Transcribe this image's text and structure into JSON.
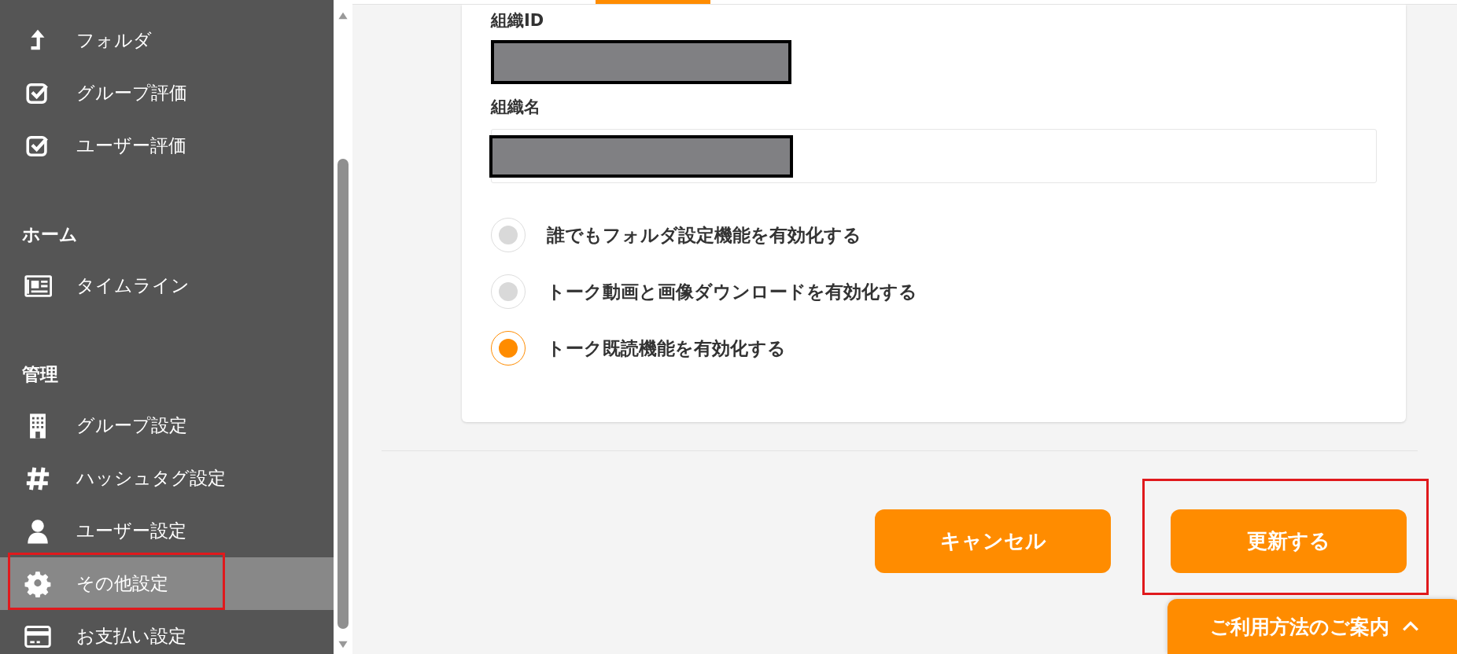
{
  "sidebar": {
    "sections": [
      {
        "items": [
          {
            "label": "フォルダ",
            "kind": "folder-up",
            "selected": false,
            "highlighted": false
          },
          {
            "label": "グループ評価",
            "kind": "check",
            "selected": false,
            "highlighted": false
          },
          {
            "label": "ユーザー評価",
            "kind": "check",
            "selected": false,
            "highlighted": false
          }
        ]
      },
      {
        "heading": "ホーム",
        "items": [
          {
            "label": "タイムライン",
            "kind": "news",
            "selected": false,
            "highlighted": false
          }
        ]
      },
      {
        "heading": "管理",
        "items": [
          {
            "label": "グループ設定",
            "kind": "building",
            "selected": false,
            "highlighted": false
          },
          {
            "label": "ハッシュタグ設定",
            "kind": "hash",
            "selected": false,
            "highlighted": false
          },
          {
            "label": "ユーザー設定",
            "kind": "user",
            "selected": false,
            "highlighted": false
          },
          {
            "label": "その他設定",
            "kind": "gear",
            "selected": true,
            "highlighted": true
          },
          {
            "label": "お支払い設定",
            "kind": "card",
            "selected": false,
            "highlighted": false
          }
        ]
      }
    ]
  },
  "form": {
    "fields": [
      {
        "label": "組織ID",
        "kind": "plain",
        "redacted": true
      },
      {
        "label": "組織名",
        "kind": "input",
        "redacted": true
      }
    ],
    "options": [
      {
        "label": "誰でもフォルダ設定機能を有効化する",
        "selected": false
      },
      {
        "label": "トーク動画と画像ダウンロードを有効化する",
        "selected": false
      },
      {
        "label": "トーク既読機能を有効化する",
        "selected": true
      }
    ]
  },
  "buttons": [
    {
      "label": "キャンセル",
      "highlighted": false
    },
    {
      "label": "更新する",
      "highlighted": true
    }
  ],
  "help_tab": {
    "label": "ご利用方法のご案内",
    "expanded": false
  }
}
